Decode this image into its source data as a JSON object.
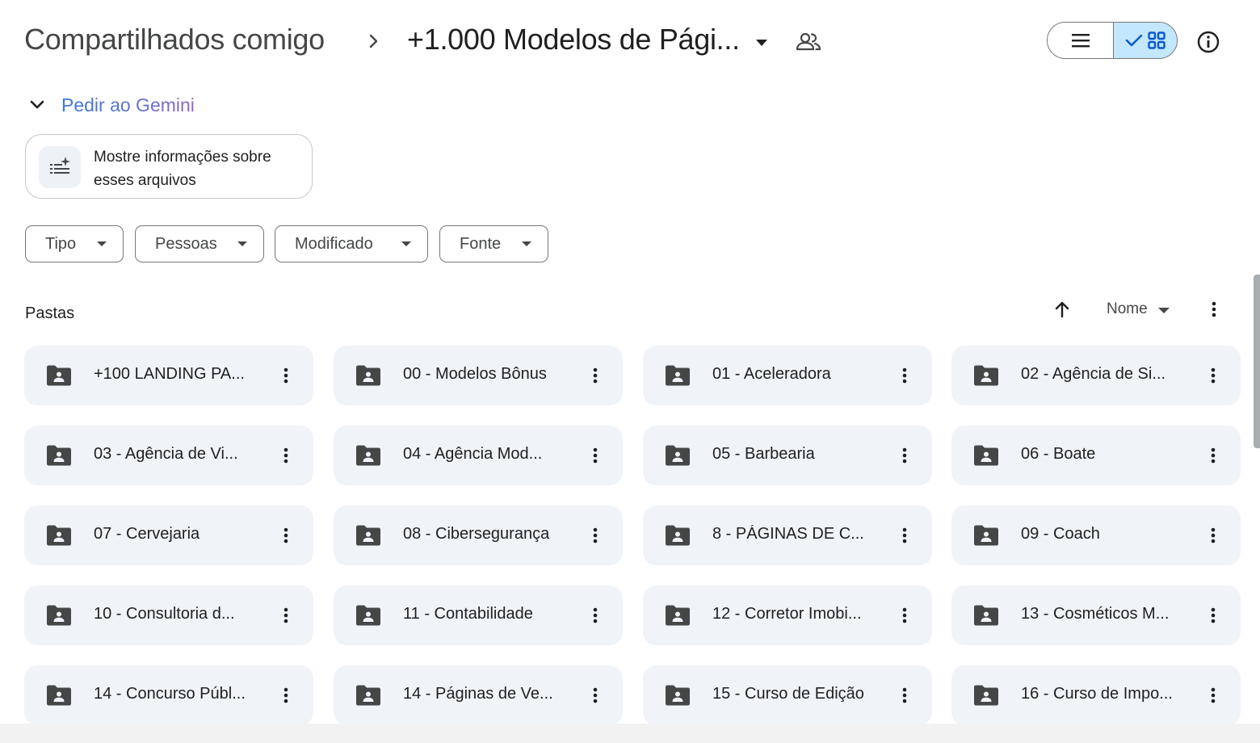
{
  "header": {
    "breadcrumb_root": "Compartilhados comigo",
    "breadcrumb_current": "+1.000 Modelos de Pági...",
    "icons": [
      "chevron-right-icon",
      "dropdown-arrow-icon",
      "shared-people-icon",
      "list-view-icon",
      "check-icon",
      "grid-view-icon",
      "info-icon"
    ],
    "active_view": "grid"
  },
  "gemini": {
    "toggle_label": "Pedir ao Gemini",
    "suggestion_text": "Mostre informações sobre esses arquivos"
  },
  "filters": [
    {
      "label": "Tipo"
    },
    {
      "label": "Pessoas"
    },
    {
      "label": "Modificado"
    },
    {
      "label": "Fonte"
    }
  ],
  "folders_section": {
    "title": "Pastas",
    "sort_label": "Nome",
    "sort_direction": "ascending",
    "items": [
      {
        "name": "+100 LANDING PA..."
      },
      {
        "name": "00 - Modelos Bônus"
      },
      {
        "name": "01 - Aceleradora"
      },
      {
        "name": "02 - Agência de Si..."
      },
      {
        "name": "03 - Agência de Vi..."
      },
      {
        "name": "04 - Agência Mod..."
      },
      {
        "name": "05 - Barbearia"
      },
      {
        "name": "06 - Boate"
      },
      {
        "name": "07 - Cervejaria"
      },
      {
        "name": "08 - Cibersegurança"
      },
      {
        "name": "8 - PÁGINAS DE C..."
      },
      {
        "name": "09 - Coach"
      },
      {
        "name": "10 - Consultoria d..."
      },
      {
        "name": "11 - Contabilidade"
      },
      {
        "name": "12 - Corretor Imobi..."
      },
      {
        "name": "13 - Cosméticos M..."
      },
      {
        "name": "14 - Concurso Públ..."
      },
      {
        "name": "14 - Páginas de Ve..."
      },
      {
        "name": "15 - Curso de Edição"
      },
      {
        "name": "16 - Curso de Impo..."
      }
    ]
  },
  "colors": {
    "accent_selected": "#c2e7ff",
    "folder_bg": "#f0f4f9",
    "gemini_blue": "#3a78d9",
    "text_primary": "#1f1f1f",
    "text_secondary": "#444746"
  }
}
